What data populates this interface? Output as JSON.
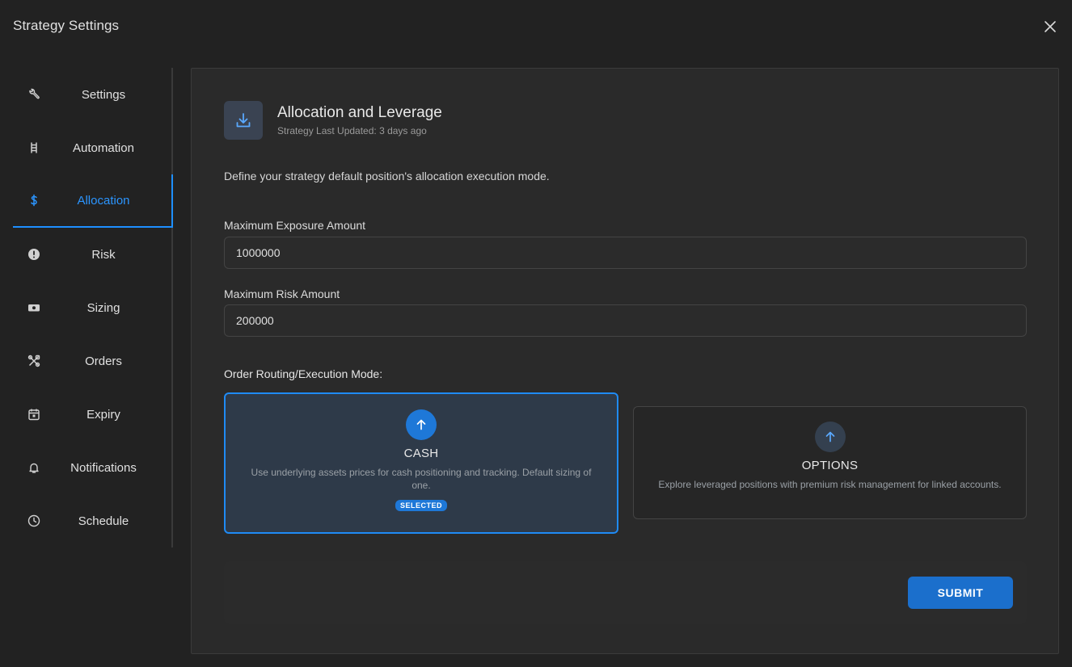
{
  "dialog": {
    "title": "Strategy Settings",
    "close_icon": "close-icon"
  },
  "sidebar": {
    "items": [
      {
        "label": "Settings",
        "icon": "wrench-icon",
        "active": false
      },
      {
        "label": "Automation",
        "icon": "ladder-icon",
        "active": false
      },
      {
        "label": "Allocation",
        "icon": "dollar-icon",
        "active": true
      },
      {
        "label": "Risk",
        "icon": "alert-circle-icon",
        "active": false
      },
      {
        "label": "Sizing",
        "icon": "cash-icon",
        "active": false
      },
      {
        "label": "Orders",
        "icon": "tools-icon",
        "active": false
      },
      {
        "label": "Expiry",
        "icon": "calendar-icon",
        "active": false
      },
      {
        "label": "Notifications",
        "icon": "bell-icon",
        "active": false
      },
      {
        "label": "Schedule",
        "icon": "clock-icon",
        "active": false
      }
    ]
  },
  "header": {
    "icon": "download-icon",
    "title": "Allocation and Leverage",
    "subtitle": "Strategy Last Updated: 3 days ago"
  },
  "description": "Define your strategy default position's allocation execution mode.",
  "fields": {
    "max_exposure": {
      "label": "Maximum Exposure Amount",
      "value": "1000000"
    },
    "max_risk": {
      "label": "Maximum Risk Amount",
      "value": "200000"
    }
  },
  "routing": {
    "label": "Order Routing/Execution Mode:",
    "cash": {
      "title": "CASH",
      "description": "Use underlying assets prices for cash positioning and tracking. Default sizing of one.",
      "badge": "SELECTED",
      "icon": "arrow-up-icon"
    },
    "options": {
      "title": "OPTIONS",
      "description": "Explore leveraged positions with premium risk management for linked accounts.",
      "icon": "arrow-up-icon"
    }
  },
  "submit_label": "SUBMIT",
  "colors": {
    "accent": "#1e8fff",
    "background": "#222222",
    "panel": "#2a2a2a"
  }
}
